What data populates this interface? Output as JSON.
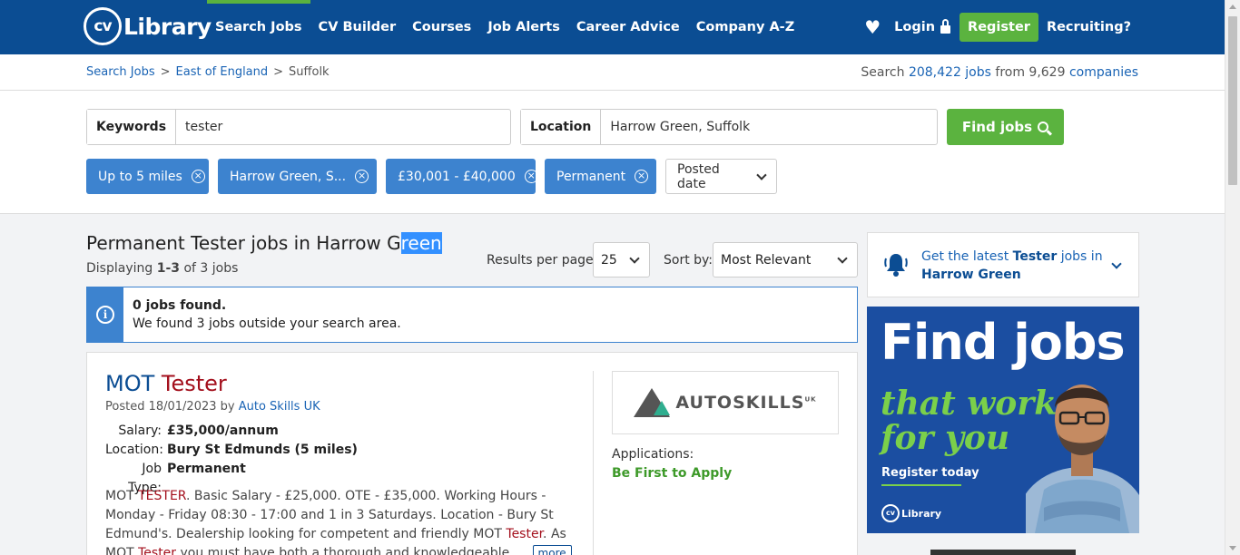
{
  "header": {
    "logo_cv": "cv",
    "logo_library": "Library",
    "nav": [
      "Search Jobs",
      "CV Builder",
      "Courses",
      "Job Alerts",
      "Career Advice",
      "Company A-Z"
    ],
    "login": "Login",
    "register": "Register",
    "recruiting": "Recruiting?"
  },
  "breadcrumb": {
    "items": [
      "Search Jobs",
      "East of England",
      "Suffolk"
    ],
    "separator": ">"
  },
  "stats": {
    "prefix": "Search ",
    "jobs_link": "208,422 jobs",
    "middle": " from 9,629 ",
    "companies_link": "companies"
  },
  "search": {
    "keywords_label": "Keywords",
    "keywords_value": "tester",
    "location_label": "Location",
    "location_value": "Harrow Green, Suffolk",
    "find_button": "Find jobs"
  },
  "filters": {
    "chips": [
      "Up to 5 miles",
      "Harrow Green, S...",
      "£30,001 - £40,000",
      "Permanent"
    ],
    "remove_glyph": "×",
    "posted_date": "Posted date"
  },
  "results": {
    "title_main": "Permanent Tester jobs in Harrow G",
    "title_highlight": "reen",
    "displaying_prefix": "Displaying ",
    "displaying_range": "1-3",
    "displaying_suffix": " of 3 jobs",
    "rpp_label": "Results per page:",
    "rpp_value": "25",
    "sort_label": "Sort by:",
    "sort_value": "Most Relevant"
  },
  "info": {
    "icon": "i",
    "line1": "0 jobs found.",
    "line2": "We found 3 jobs outside your search area."
  },
  "job": {
    "title_a": "MOT",
    "title_b": "Tester",
    "posted_prefix": "Posted 18/01/2023 by ",
    "company": "Auto Skills UK",
    "salary_label": "Salary:",
    "salary": "£35,000/annum",
    "location_label": "Location:",
    "location": "Bury St Edmunds (5 miles)",
    "type_label": "Job Type:",
    "type": "Permanent",
    "desc_1": "MOT ",
    "desc_kw1": "TESTER",
    "desc_2": ". Basic Salary - £25,000. OTE - £35,000. Working Hours - Monday - Friday 08:30 - 17:00 and 1 in 3 Saturdays. Location - Bury St Edmund's. Dealership looking for competent and friendly MOT ",
    "desc_kw2": "Tester",
    "desc_3": ". As MOT ",
    "desc_kw3": "Tester",
    "desc_4": " you must have both a thorough and knowledgeable...",
    "more": "more",
    "company_logo_text": "AUTOSKILLS",
    "company_logo_sup": "UK",
    "applications_label": "Applications:",
    "applications_value": "Be First to Apply"
  },
  "alert": {
    "prefix": "Get the latest ",
    "keyword": "Tester",
    "middle": " jobs in ",
    "place": "Harrow Green"
  },
  "ad": {
    "headline": "Find jobs",
    "tagline_1": "that work",
    "tagline_2": "for you",
    "cta": "Register today",
    "logo_cv": "cv",
    "logo_library": "Library"
  },
  "colors": {
    "brand_blue": "#0b4d93",
    "accent_green": "#5bb33f",
    "chip_blue": "#3d83cf",
    "keyword_red": "#a30f1c"
  }
}
